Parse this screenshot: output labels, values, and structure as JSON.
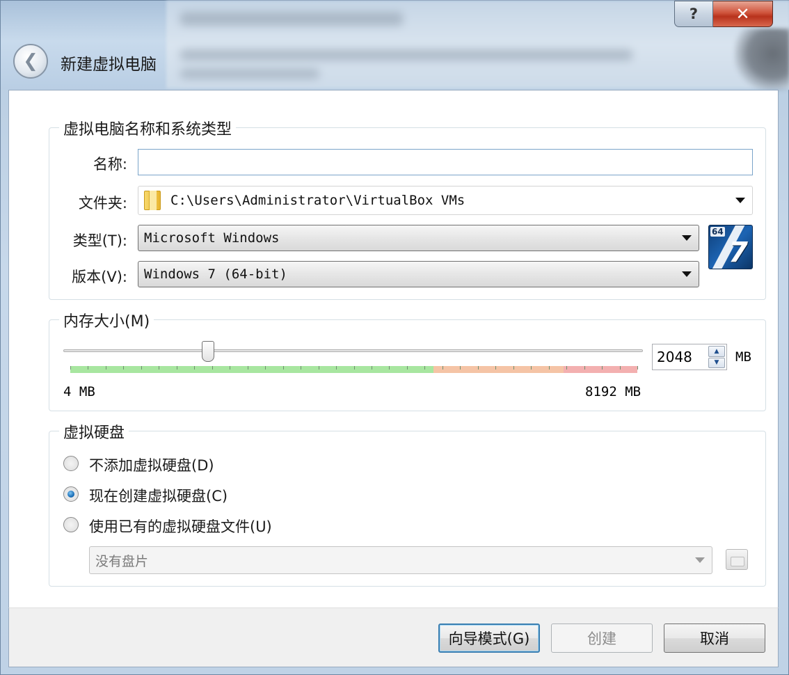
{
  "window": {
    "title": "新建虚拟电脑",
    "help_glyph": "?",
    "close_glyph": "✕"
  },
  "icons": {
    "back": "back-arrow-icon",
    "folder": "folder-icon",
    "os": "windows-7-64-icon",
    "disk": "hard-disk-icon"
  },
  "name_group": {
    "title": "虚拟电脑名称和系统类型",
    "name_label": "名称:",
    "name_value": "",
    "folder_label": "文件夹:",
    "folder_value": "C:\\Users\\Administrator\\VirtualBox VMs",
    "type_label": "类型(T):",
    "type_value": "Microsoft Windows",
    "version_label": "版本(V):",
    "version_value": "Windows 7 (64-bit)",
    "os_badge": "64",
    "os_number": "7"
  },
  "memory_group": {
    "title": "内存大小(M)",
    "value": "2048",
    "unit": "MB",
    "min_label": "4 MB",
    "max_label": "8192 MB",
    "min": 4,
    "max": 8192,
    "current": 2048,
    "colors": {
      "green": "#a8e6a0",
      "orange": "#f5c4a6",
      "red": "#f3b0b0"
    }
  },
  "disk_group": {
    "title": "虚拟硬盘",
    "options": [
      {
        "label": "不添加虚拟硬盘(D)",
        "selected": false
      },
      {
        "label": "现在创建虚拟硬盘(C)",
        "selected": true
      },
      {
        "label": "使用已有的虚拟硬盘文件(U)",
        "selected": false
      }
    ],
    "disk_select_value": "没有盘片"
  },
  "footer": {
    "guided_mode": "向导模式(G)",
    "create": "创建",
    "cancel": "取消"
  }
}
